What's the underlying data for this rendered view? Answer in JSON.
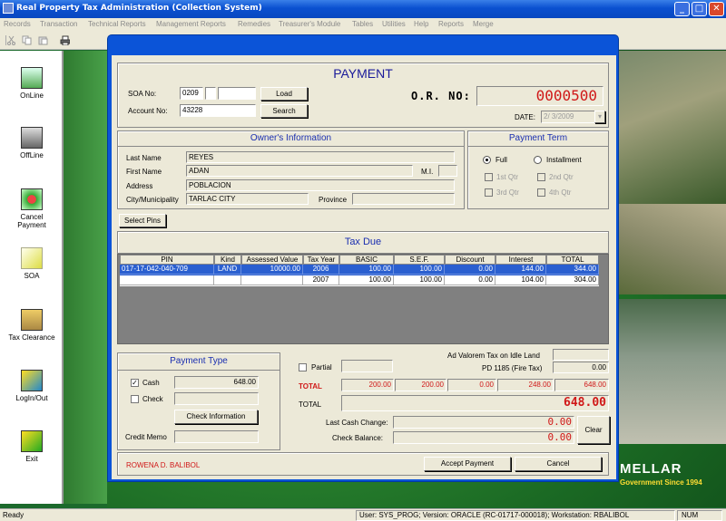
{
  "app": {
    "title": "Real Property Tax Administration (Collection System)"
  },
  "window_buttons": {
    "minimize": "_",
    "maximize": "□",
    "close": "✕"
  },
  "menu": [
    "Records",
    "Transaction",
    "Technical Reports",
    "Management Reports",
    "Remedies",
    "Treasurer's Module",
    "Tables",
    "Utilities",
    "Help",
    "Reports",
    "Merge"
  ],
  "sidebar": [
    {
      "label": "OnLine",
      "icon": "online-icon"
    },
    {
      "label": "OffLine",
      "icon": "offline-icon"
    },
    {
      "label": "Cancel Payment",
      "icon": "cancel-payment-icon"
    },
    {
      "label": "SOA",
      "icon": "soa-icon"
    },
    {
      "label": "Tax Clearance",
      "icon": "tax-clearance-icon"
    },
    {
      "label": "LogIn/Out",
      "icon": "login-icon"
    },
    {
      "label": "Exit",
      "icon": "exit-icon"
    }
  ],
  "background": {
    "brand": "MELLAR",
    "slogan": "Government Since 1994"
  },
  "dialog": {
    "title": "PAYMENT",
    "soa_label": "SOA No:",
    "soa_value": "0209",
    "account_label": "Account No:",
    "account_value": "43228",
    "load_button": "Load",
    "search_button": "Search",
    "or_label": "O.R. NO:",
    "or_value": "0000500",
    "date_label": "DATE:",
    "date_value": "2/ 3/2009",
    "owner": {
      "header": "Owner's Information",
      "last_name_label": "Last Name",
      "last_name": "REYES",
      "first_name_label": "First Name",
      "first_name": "ADAN",
      "mi_label": "M.I.",
      "address_label": "Address",
      "address": "POBLACION",
      "city_label": "City/Municipality",
      "city": "TARLAC CITY",
      "province_label": "Province"
    },
    "payment_term": {
      "header": "Payment Term",
      "full": "Full",
      "installment": "Installment",
      "q1": "1st Qtr",
      "q2": "2nd Qtr",
      "q3": "3rd Qtr",
      "q4": "4th Qtr"
    },
    "select_pins_button": "Select Pins",
    "tax_due": {
      "header": "Tax Due",
      "columns": [
        "PIN",
        "Kind",
        "Assessed Value",
        "Tax Year",
        "BASIC",
        "S.E.F.",
        "Discount",
        "Interest",
        "TOTAL"
      ],
      "rows": [
        [
          "017-17-042-040-709",
          "LAND",
          "10000.00",
          "2006",
          "100.00",
          "100.00",
          "0.00",
          "144.00",
          "344.00"
        ],
        [
          "",
          "",
          "",
          "2007",
          "100.00",
          "100.00",
          "0.00",
          "104.00",
          "304.00"
        ]
      ]
    },
    "payment_type": {
      "header": "Payment Type",
      "cash_label": "Cash",
      "cash_value": "648.00",
      "check_label": "Check",
      "check_info_button": "Check Information",
      "credit_memo_label": "Credit Memo"
    },
    "summary": {
      "ad_valorem_label": "Ad Valorem Tax on Idle Land",
      "pd_label": "PD 1185 (Fire Tax)",
      "pd_value": "0.00",
      "partial_label": "Partial",
      "total_red_label": "TOTAL",
      "totals": [
        "200.00",
        "200.00",
        "0.00",
        "248.00",
        "648.00"
      ],
      "total_label": "TOTAL",
      "total_value": "648.00",
      "last_cash_change_label": "Last Cash Change:",
      "last_cash_change": "0.00",
      "check_balance_label": "Check Balance:",
      "check_balance": "0.00",
      "clear_button": "Clear"
    },
    "cashier": "ROWENA D. BALIBOL",
    "accept_button": "Accept Payment",
    "cancel_button": "Cancel"
  },
  "status": {
    "left": "Ready",
    "info": "User: SYS_PROG; Version: ORACLE (RC-01717-000018); Workstation: RBALIBOL",
    "num": "NUM"
  },
  "colors": {
    "titlebar": "#0a50d0",
    "header_text": "#1a2eb0",
    "red": "#d01818",
    "selected_row": "#2a5fd0"
  }
}
